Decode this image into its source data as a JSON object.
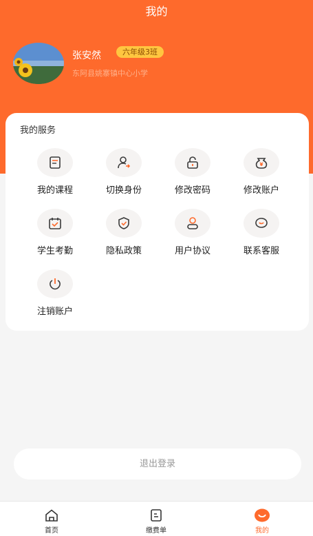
{
  "header": {
    "title": "我的"
  },
  "profile": {
    "name": "张安然",
    "grade": "六年级3班",
    "school": "东阿县姚寨镇中心小学"
  },
  "services": {
    "title": "我的服务",
    "items": [
      {
        "label": "我的课程",
        "icon": "book-icon"
      },
      {
        "label": "切换身份",
        "icon": "user-switch-icon"
      },
      {
        "label": "修改密码",
        "icon": "lock-icon"
      },
      {
        "label": "修改账户",
        "icon": "yuan-wallet-icon"
      },
      {
        "label": "学生考勤",
        "icon": "calendar-check-icon"
      },
      {
        "label": "隐私政策",
        "icon": "shield-check-icon"
      },
      {
        "label": "用户协议",
        "icon": "user-agreement-icon"
      },
      {
        "label": "联系客服",
        "icon": "chat-icon"
      },
      {
        "label": "注销账户",
        "icon": "power-icon"
      }
    ]
  },
  "logout": {
    "label": "退出登录"
  },
  "tabbar": {
    "tabs": [
      {
        "label": "首页",
        "icon": "home-icon"
      },
      {
        "label": "缴费单",
        "icon": "bill-icon"
      },
      {
        "label": "我的",
        "icon": "profile-smile-icon"
      }
    ]
  },
  "colors": {
    "accent": "#fe6a2c",
    "badge": "#ffc640",
    "background": "#f5f5f5"
  }
}
